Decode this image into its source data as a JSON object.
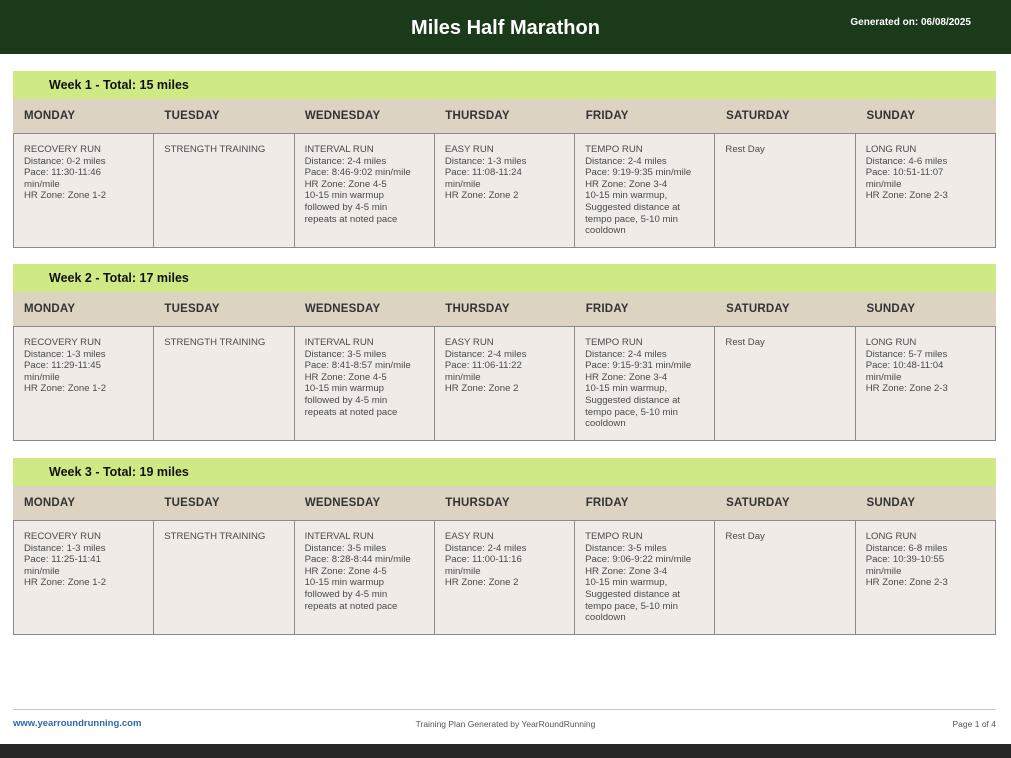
{
  "header": {
    "title": "Miles Half Marathon",
    "generated": "Generated on: 06/08/2025"
  },
  "day_names": [
    "MONDAY",
    "TUESDAY",
    "WEDNESDAY",
    "THURSDAY",
    "FRIDAY",
    "SATURDAY",
    "SUNDAY"
  ],
  "weeks": [
    {
      "title": "Week 1 - Total: 15 miles",
      "days": [
        [
          "RECOVERY RUN",
          "Distance: 0-2 miles",
          "Pace: 11:30-11:46",
          "min/mile",
          "HR Zone: Zone 1-2"
        ],
        [
          "STRENGTH TRAINING"
        ],
        [
          "INTERVAL RUN",
          "Distance: 2-4 miles",
          "Pace: 8:46-9:02 min/mile",
          "HR Zone: Zone 4-5",
          "10-15 min warmup",
          "followed by 4-5 min",
          "repeats at noted pace"
        ],
        [
          "EASY RUN",
          "Distance: 1-3 miles",
          "Pace: 11:08-11:24",
          "min/mile",
          "HR Zone: Zone 2"
        ],
        [
          "TEMPO RUN",
          "Distance: 2-4 miles",
          "Pace: 9:19-9:35 min/mile",
          "HR Zone: Zone 3-4",
          "10-15 min warmup,",
          "Suggested distance at",
          "tempo pace, 5-10 min",
          "cooldown"
        ],
        [
          "Rest Day"
        ],
        [
          "LONG RUN",
          "Distance: 4-6 miles",
          "Pace: 10:51-11:07",
          "min/mile",
          "HR Zone: Zone 2-3"
        ]
      ]
    },
    {
      "title": "Week 2 - Total: 17 miles",
      "days": [
        [
          "RECOVERY RUN",
          "Distance: 1-3 miles",
          "Pace: 11:29-11:45",
          "min/mile",
          "HR Zone: Zone 1-2"
        ],
        [
          "STRENGTH TRAINING"
        ],
        [
          "INTERVAL RUN",
          "Distance: 3-5 miles",
          "Pace: 8:41-8:57 min/mile",
          "HR Zone: Zone 4-5",
          "10-15 min warmup",
          "followed by 4-5 min",
          "repeats at noted pace"
        ],
        [
          "EASY RUN",
          "Distance: 2-4 miles",
          "Pace: 11:06-11:22",
          "min/mile",
          "HR Zone: Zone 2"
        ],
        [
          "TEMPO RUN",
          "Distance: 2-4 miles",
          "Pace: 9:15-9:31 min/mile",
          "HR Zone: Zone 3-4",
          "10-15 min warmup,",
          "Suggested distance at",
          "tempo pace, 5-10 min",
          "cooldown"
        ],
        [
          "Rest Day"
        ],
        [
          "LONG RUN",
          "Distance: 5-7 miles",
          "Pace: 10:48-11:04",
          "min/mile",
          "HR Zone: Zone 2-3"
        ]
      ]
    },
    {
      "title": "Week 3 - Total: 19 miles",
      "days": [
        [
          "RECOVERY RUN",
          "Distance: 1-3 miles",
          "Pace: 11:25-11:41",
          "min/mile",
          "HR Zone: Zone 1-2"
        ],
        [
          "STRENGTH TRAINING"
        ],
        [
          "INTERVAL RUN",
          "Distance: 3-5 miles",
          "Pace: 8:28-8:44 min/mile",
          "HR Zone: Zone 4-5",
          "10-15 min warmup",
          "followed by 4-5 min",
          "repeats at noted pace"
        ],
        [
          "EASY RUN",
          "Distance: 2-4 miles",
          "Pace: 11:00-11:16",
          "min/mile",
          "HR Zone: Zone 2"
        ],
        [
          "TEMPO RUN",
          "Distance: 3-5 miles",
          "Pace: 9:06-9:22 min/mile",
          "HR Zone: Zone 3-4",
          "10-15 min warmup,",
          "Suggested distance at",
          "tempo pace, 5-10 min",
          "cooldown"
        ],
        [
          "Rest Day"
        ],
        [
          "LONG RUN",
          "Distance: 6-8 miles",
          "Pace: 10:39-10:55",
          "min/mile",
          "HR Zone: Zone 2-3"
        ]
      ]
    }
  ],
  "footer": {
    "website": "www.yearroundrunning.com",
    "credit": "Training Plan Generated by YearRoundRunning",
    "page": "Page 1 of 4"
  },
  "colors": {
    "header_bg": "#1b3a1a",
    "week_banner": "#cfea85",
    "day_header_bg": "#dcd3c3",
    "cell_bg": "#f1ebe8",
    "link": "#2f6aa7"
  }
}
